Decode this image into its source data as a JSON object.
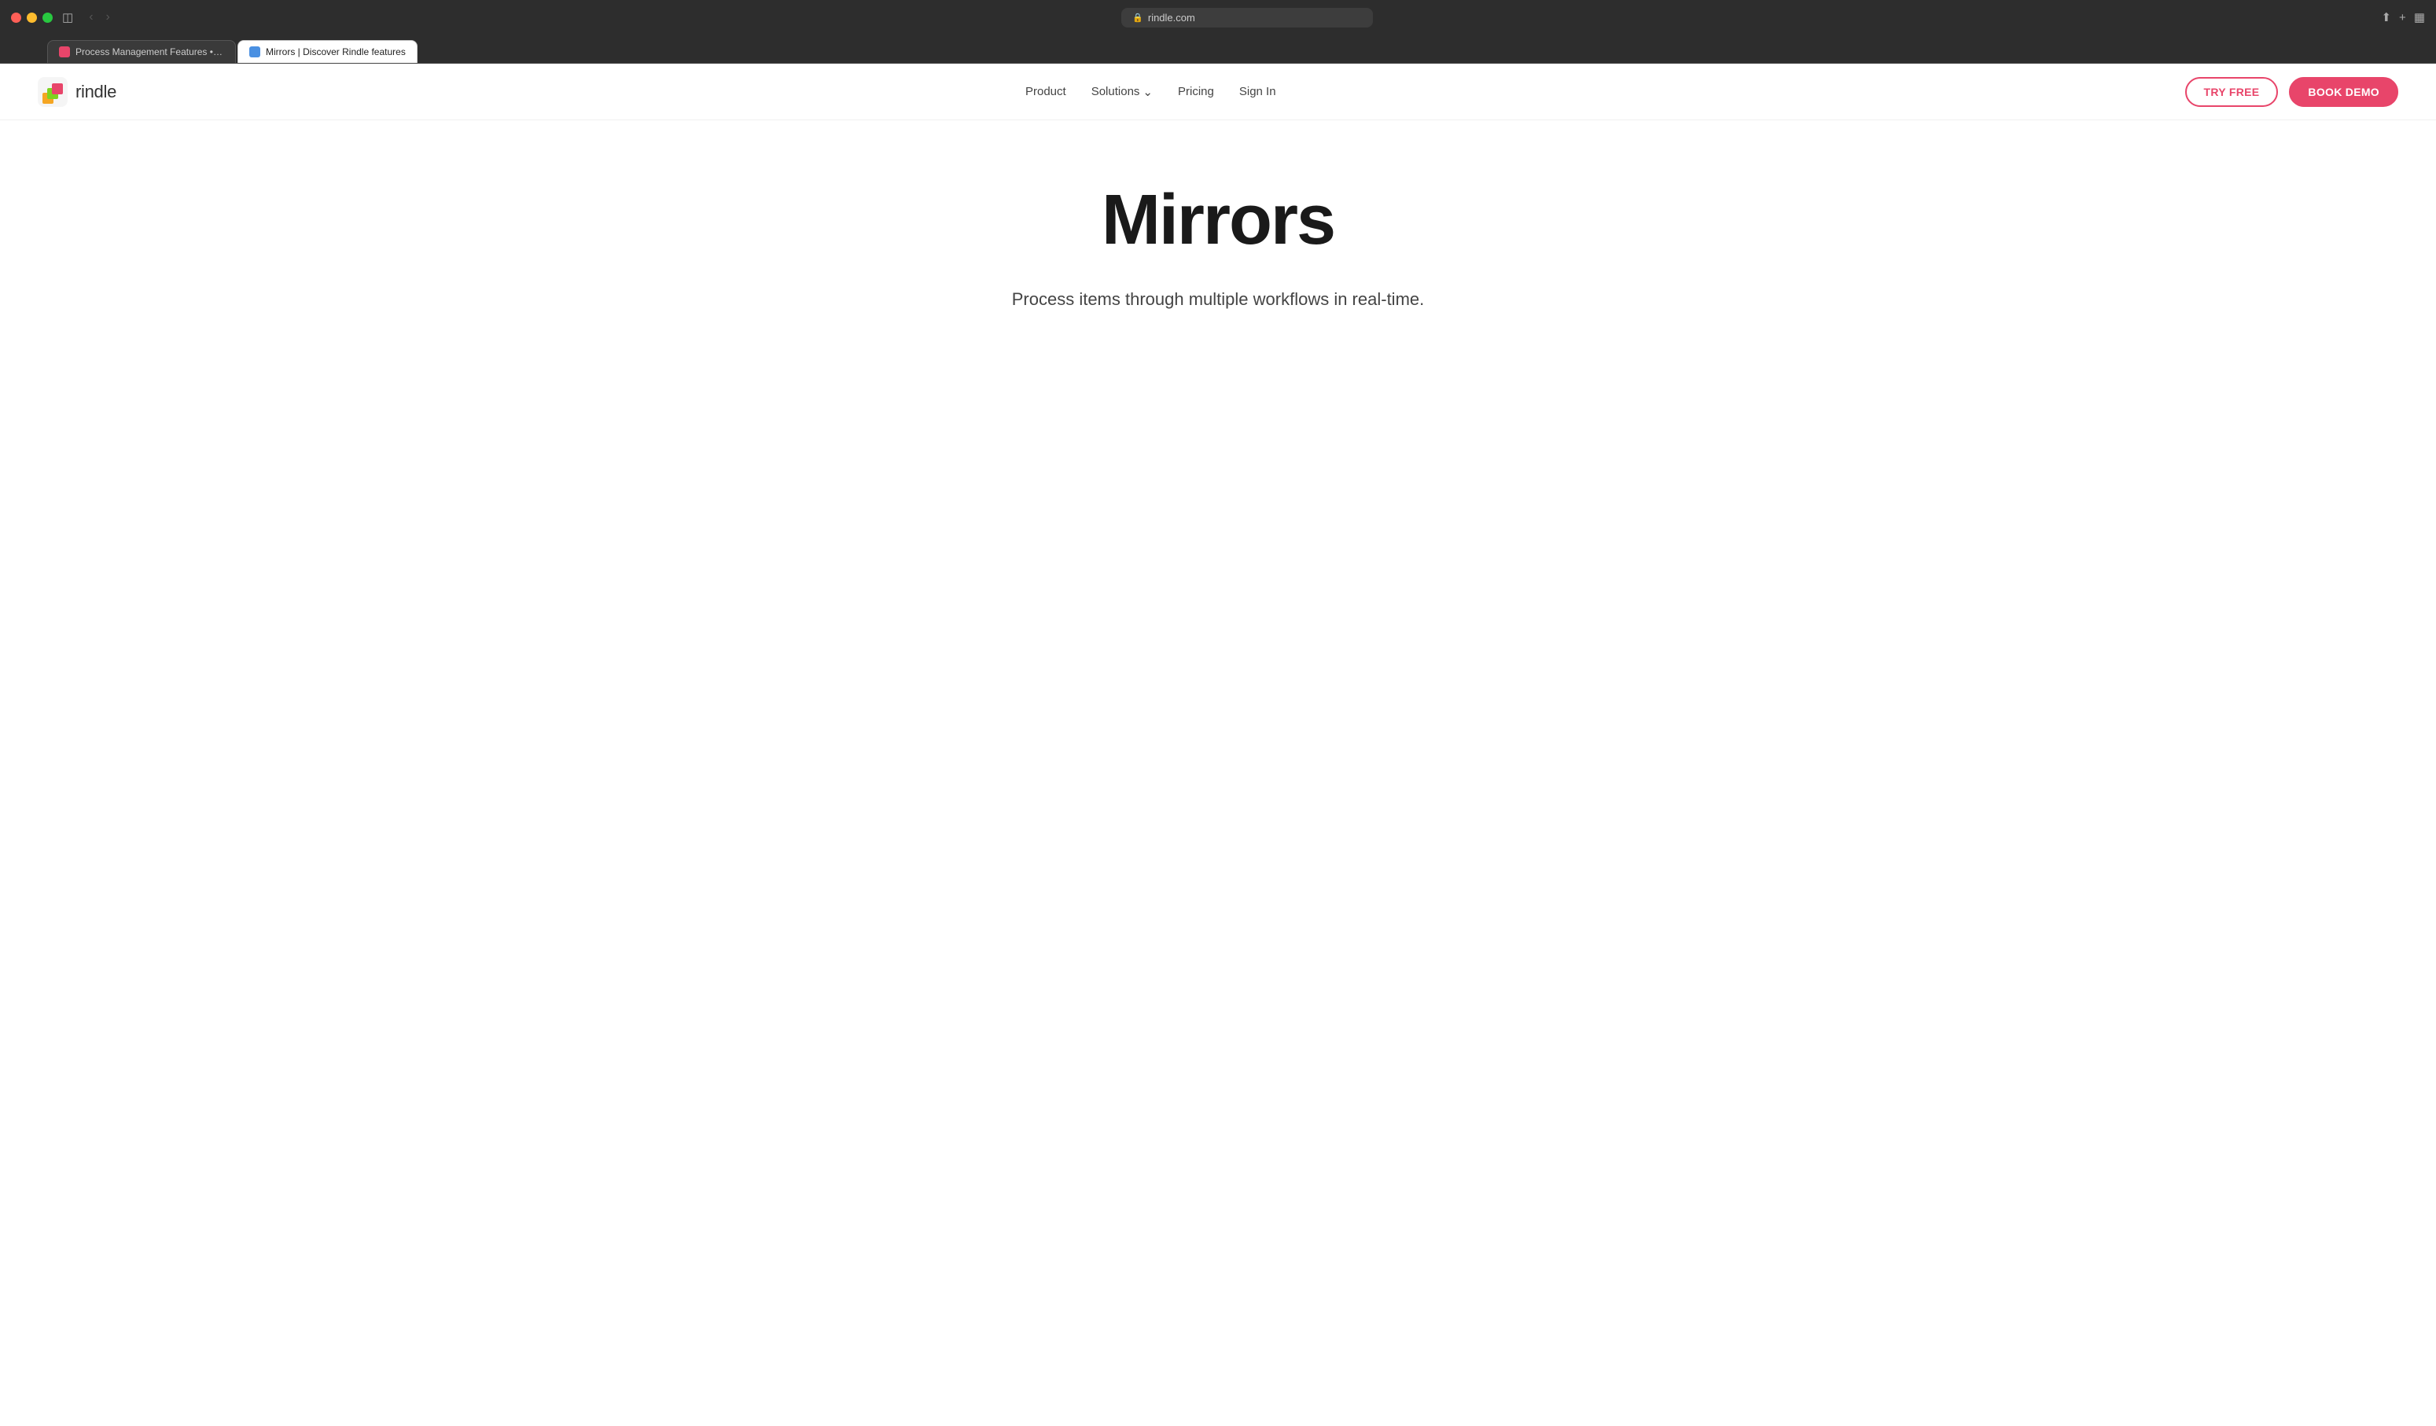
{
  "browser": {
    "url": "rindle.com",
    "tabs": [
      {
        "id": "tab-1",
        "label": "Process Management Features • Rindle",
        "active": false,
        "favicon_color": "#e8456a"
      },
      {
        "id": "tab-2",
        "label": "Mirrors | Discover Rindle features",
        "active": true,
        "favicon_color": "#4a90e2"
      }
    ],
    "back_enabled": false,
    "forward_enabled": false
  },
  "navbar": {
    "brand_name": "rindle",
    "nav_links": [
      {
        "id": "product",
        "label": "Product",
        "has_dropdown": false
      },
      {
        "id": "solutions",
        "label": "Solutions",
        "has_dropdown": true
      },
      {
        "id": "pricing",
        "label": "Pricing",
        "has_dropdown": false
      },
      {
        "id": "sign-in",
        "label": "Sign In",
        "has_dropdown": false
      }
    ],
    "try_free_label": "TRY FREE",
    "book_demo_label": "BOOK DEMO"
  },
  "hero": {
    "title": "Mirrors",
    "subtitle": "Process items through multiple workflows in real-time."
  },
  "colors": {
    "brand_red": "#e8456a",
    "text_dark": "#1a1a1a",
    "text_mid": "#444444"
  }
}
